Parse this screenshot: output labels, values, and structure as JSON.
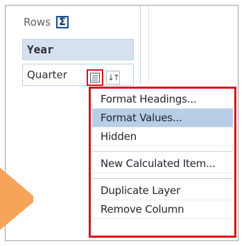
{
  "rows_panel": {
    "label": "Rows",
    "sigma_icon_glyph": "Σ",
    "items": [
      {
        "label": "Year"
      },
      {
        "label": "Quarter"
      }
    ],
    "sort_glyph": "↓↑"
  },
  "context_menu": {
    "items": [
      {
        "label": "Format Headings...",
        "state": "normal"
      },
      {
        "label": "Format Values...",
        "state": "selected"
      },
      {
        "label": "Hidden",
        "state": "normal"
      },
      {
        "label": "New Calculated Item...",
        "state": "normal"
      },
      {
        "label": "Duplicate Layer",
        "state": "normal"
      },
      {
        "label": "Remove Column",
        "state": "normal"
      }
    ]
  },
  "colors": {
    "highlight_red": "#d6111a",
    "selected_bg": "#b8cde6",
    "year_bg": "#d5e1ee",
    "accent_orange": "#f6a45a"
  }
}
